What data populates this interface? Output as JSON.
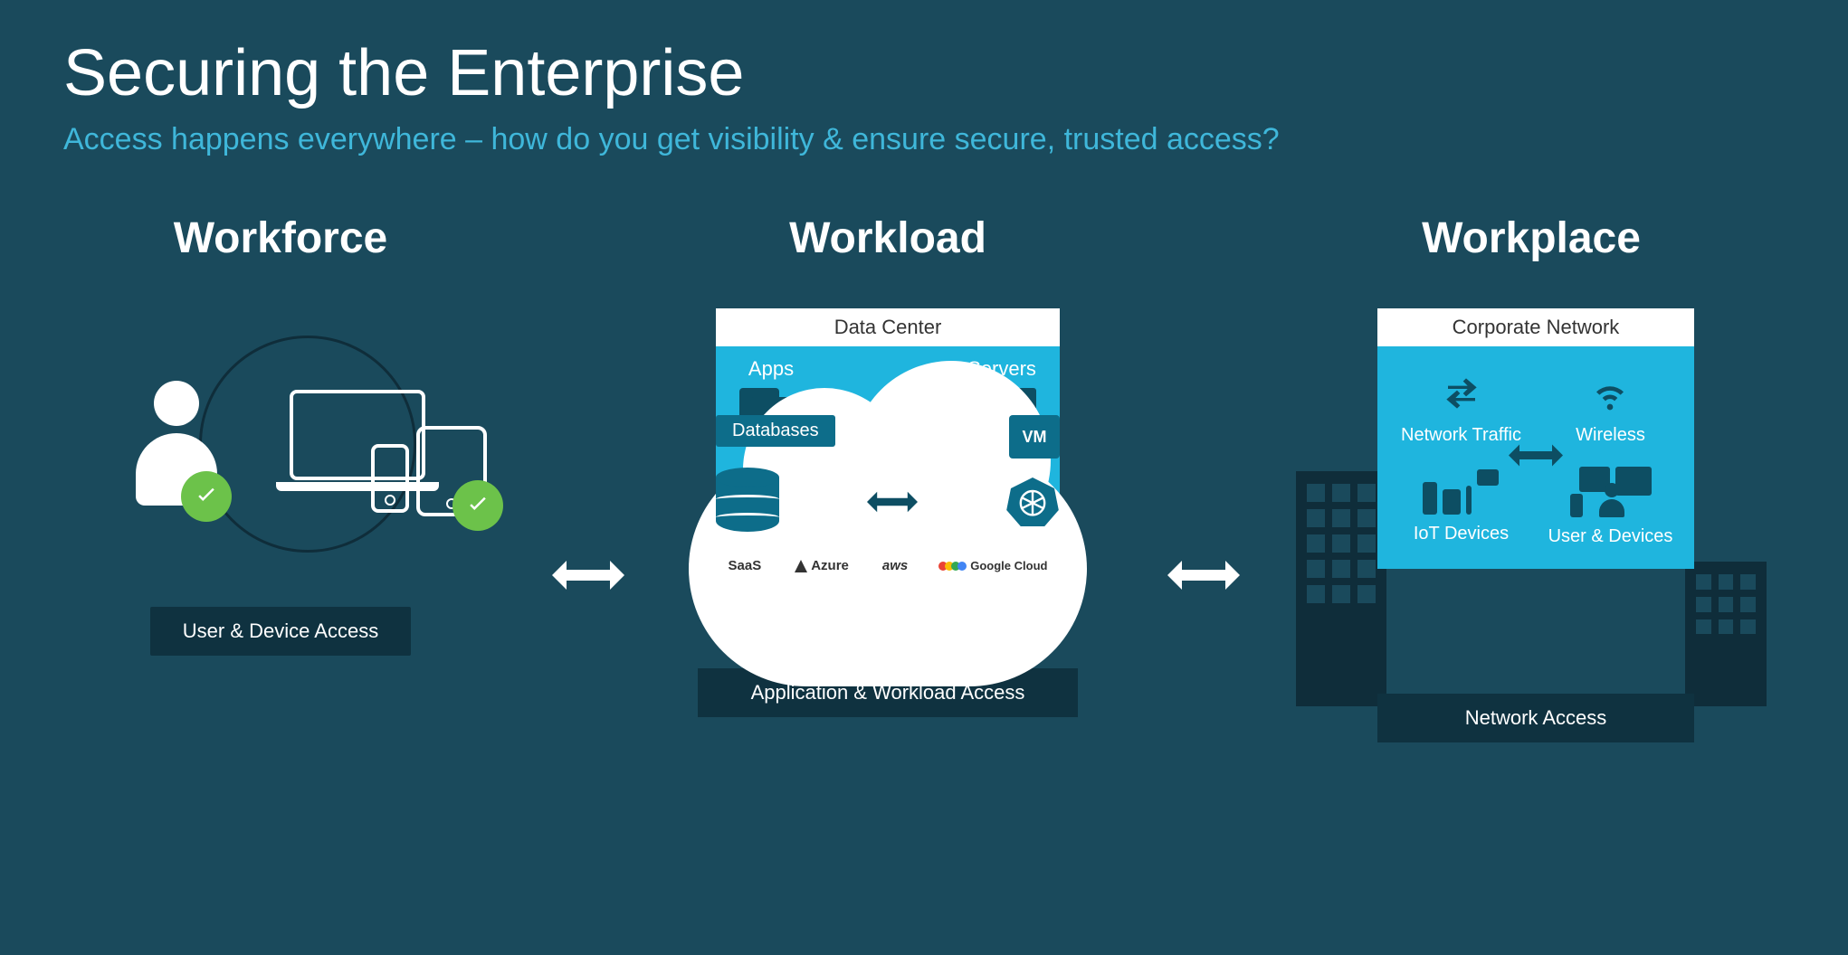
{
  "title": "Securing the Enterprise",
  "subtitle": "Access happens everywhere – how do you get visibility & ensure secure, trusted access?",
  "columns": {
    "workforce": {
      "heading": "Workforce",
      "footer": "User & Device Access"
    },
    "workload": {
      "heading": "Workload",
      "datacenter_header": "Data Center",
      "apps_label": "Apps",
      "servers_label": "Servers",
      "databases_label": "Databases",
      "vm_label": "VM",
      "providers": {
        "saas": "SaaS",
        "azure": "Azure",
        "aws": "aws",
        "google": "Google Cloud"
      },
      "footer": "Application & Workload Access"
    },
    "workplace": {
      "heading": "Workplace",
      "corp_header": "Corporate Network",
      "network_traffic": "Network Traffic",
      "wireless": "Wireless",
      "iot_devices": "IoT Devices",
      "user_devices": "User & Devices",
      "footer": "Network Access"
    }
  }
}
